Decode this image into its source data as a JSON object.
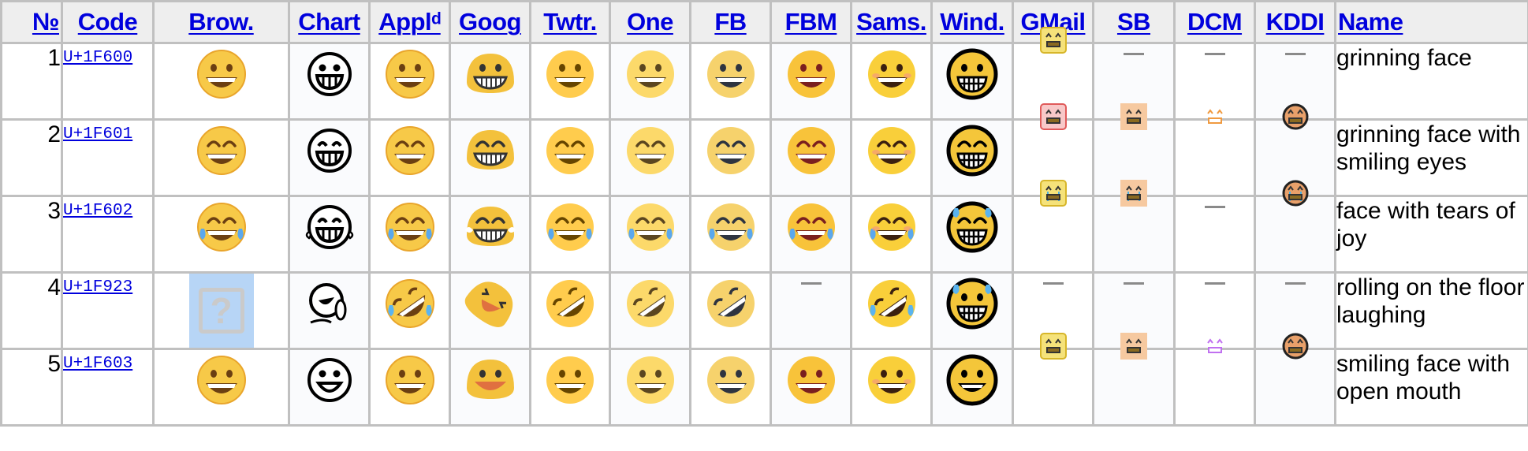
{
  "table": {
    "headers": [
      {
        "key": "num",
        "label": "№"
      },
      {
        "key": "code",
        "label": "Code"
      },
      {
        "key": "brow",
        "label": "Brow."
      },
      {
        "key": "chart",
        "label": "Chart"
      },
      {
        "key": "appl",
        "label": "Applᵈ"
      },
      {
        "key": "goog",
        "label": "Goog"
      },
      {
        "key": "twtr",
        "label": "Twtr."
      },
      {
        "key": "one",
        "label": "One"
      },
      {
        "key": "fb",
        "label": "FB"
      },
      {
        "key": "fbm",
        "label": "FBM"
      },
      {
        "key": "sams",
        "label": "Sams."
      },
      {
        "key": "wind",
        "label": "Wind."
      },
      {
        "key": "gmail",
        "label": "GMail"
      },
      {
        "key": "sb",
        "label": "SB"
      },
      {
        "key": "dcm",
        "label": "DCM"
      },
      {
        "key": "kddi",
        "label": "KDDI"
      },
      {
        "key": "name",
        "label": "Name"
      }
    ],
    "rows": [
      {
        "num": "1",
        "code": "U+1F600",
        "name": "grinning face",
        "images": {
          "brow": "grinning-face-icon",
          "chart": "grinning-face-icon",
          "appl": "grinning-face-icon",
          "goog": "grinning-face-icon",
          "twtr": "grinning-face-icon",
          "one": "grinning-face-icon",
          "fb": "grinning-face-icon",
          "fbm": "grinning-face-icon",
          "sams": "grinning-face-icon",
          "wind": "grinning-face-icon",
          "gmail": "grinning-face-icon",
          "sb": "—",
          "dcm": "—",
          "kddi": "—"
        }
      },
      {
        "num": "2",
        "code": "U+1F601",
        "name": "grinning face with smiling eyes",
        "images": {
          "brow": "beaming-face-icon",
          "chart": "beaming-face-icon",
          "appl": "beaming-face-icon",
          "goog": "beaming-face-icon",
          "twtr": "beaming-face-icon",
          "one": "beaming-face-icon",
          "fb": "beaming-face-icon",
          "fbm": "beaming-face-icon",
          "sams": "beaming-face-icon",
          "wind": "beaming-face-icon",
          "gmail": "beaming-face-icon",
          "sb": "beaming-face-icon",
          "dcm": "beaming-face-icon",
          "kddi": "beaming-face-icon"
        }
      },
      {
        "num": "3",
        "code": "U+1F602",
        "name": "face with tears of joy",
        "images": {
          "brow": "tears-of-joy-icon",
          "chart": "tears-of-joy-icon",
          "appl": "tears-of-joy-icon",
          "goog": "tears-of-joy-icon",
          "twtr": "tears-of-joy-icon",
          "one": "tears-of-joy-icon",
          "fb": "tears-of-joy-icon",
          "fbm": "tears-of-joy-icon",
          "sams": "tears-of-joy-icon",
          "wind": "tears-of-joy-icon",
          "gmail": "tears-of-joy-icon",
          "sb": "tears-of-joy-icon",
          "dcm": "—",
          "kddi": "tears-of-joy-icon"
        }
      },
      {
        "num": "4",
        "code": "U+1F923",
        "name": "rolling on the floor laughing",
        "images": {
          "brow": "missing-glyph",
          "chart": "rofl-icon",
          "appl": "rofl-icon",
          "goog": "rofl-icon",
          "twtr": "rofl-icon",
          "one": "rofl-icon",
          "fb": "rofl-icon",
          "fbm": "—",
          "sams": "rofl-icon",
          "wind": "rofl-icon",
          "gmail": "—",
          "sb": "—",
          "dcm": "—",
          "kddi": "—"
        }
      },
      {
        "num": "5",
        "code": "U+1F603",
        "name": "smiling face with open mouth",
        "images": {
          "brow": "smiley-face-icon",
          "chart": "smiley-face-icon",
          "appl": "smiley-face-icon",
          "goog": "smiley-face-icon",
          "twtr": "smiley-face-icon",
          "one": "smiley-face-icon",
          "fb": "smiley-face-icon",
          "fbm": "smiley-face-icon",
          "sams": "smiley-face-icon",
          "wind": "smiley-face-icon",
          "gmail": "smiley-face-icon",
          "sb": "smiley-face-icon",
          "dcm": "smiley-face-icon",
          "kddi": "smiley-face-icon"
        }
      }
    ],
    "missing_glyph_label": "?"
  },
  "colors": {
    "link": "#0000dd",
    "header_bg": "#eeeeee",
    "border": "#c0c0c0",
    "alt_cell_bg": "#fafbfd",
    "missing_bg": "#b7d5f6"
  }
}
